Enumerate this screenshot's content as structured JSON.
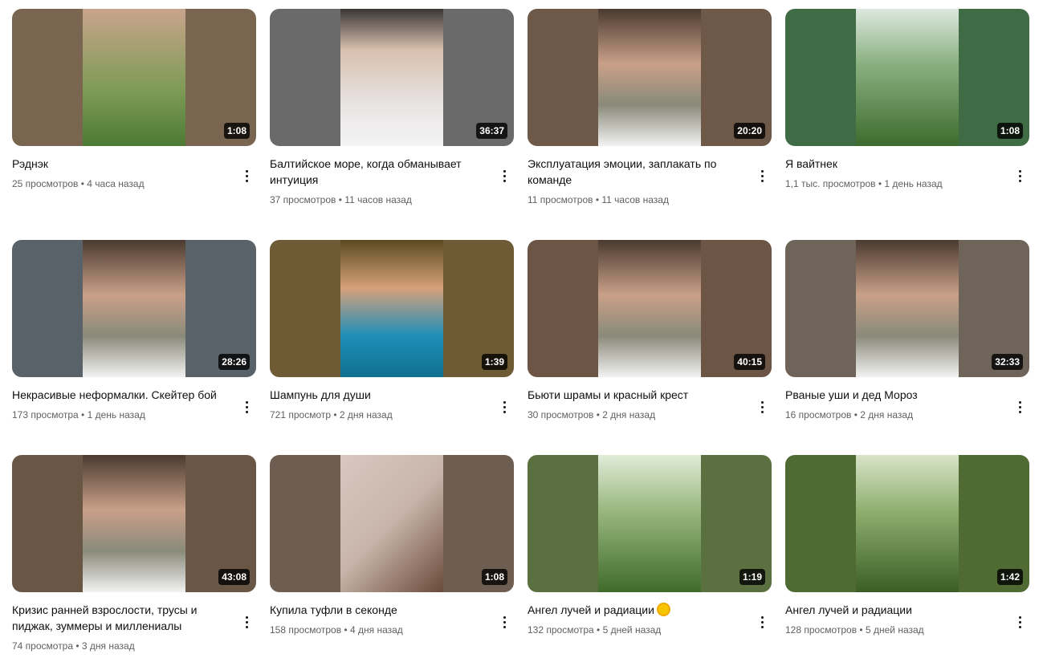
{
  "videos": [
    {
      "title": "Рэднэк",
      "views": "25 просмотров",
      "age": "4 часа назад",
      "duration": "1:08",
      "side": "#7a6650",
      "center": "linear-gradient(180deg,#c9a48c,#7d9b55 60%,#4d7a36)"
    },
    {
      "title": "Балтийское море, когда обманывает интуиция",
      "views": "37 просмотров",
      "age": "11 часов назад",
      "duration": "36:37",
      "side": "#6a6a6a",
      "center": "linear-gradient(180deg,#3a3636,#d8c0ae 30%,#e8e4e4 70%,#f4f4f4)"
    },
    {
      "title": "Эксплуатация эмоции, заплакать по команде",
      "views": "11 просмотров",
      "age": "11 часов назад",
      "duration": "20:20",
      "side": "#6e5848",
      "center": "linear-gradient(180deg,#4a3a30,#c9a088 40%,#8a8a7a 70%,#f2f2f2)"
    },
    {
      "title": "Я вайтнек",
      "views": "1,1 тыс. просмотров",
      "age": "1 день назад",
      "duration": "1:08",
      "side": "#3f6c45",
      "center": "linear-gradient(180deg,#dde8e0,#8ab080 40%,#3d6b2e)"
    },
    {
      "title": "Некрасивые неформалки. Скейтер бой",
      "views": "173 просмотра",
      "age": "1 день назад",
      "duration": "28:26",
      "side": "#596268",
      "center": "linear-gradient(180deg,#4a3a30,#c9a088 40%,#8a8a7a 70%,#f2f2f2)"
    },
    {
      "title": "Шампунь для души",
      "views": "721 просмотр",
      "age": "2 дня назад",
      "duration": "1:39",
      "side": "#6e5a34",
      "center": "linear-gradient(180deg,#5a4a20,#d6a07a 35%,#1e8fb8 70%,#107090)"
    },
    {
      "title": "Бьюти шрамы и красный крест",
      "views": "30 просмотров",
      "age": "2 дня назад",
      "duration": "40:15",
      "side": "#6d5545",
      "center": "linear-gradient(180deg,#4a3a30,#c9a088 40%,#8a8a7a 70%,#f2f2f2)"
    },
    {
      "title": "Рваные уши и дед Мороз",
      "views": "16 просмотров",
      "age": "2 дня назад",
      "duration": "32:33",
      "side": "#6f645a",
      "center": "linear-gradient(180deg,#4a3a30,#c9a088 40%,#8a8a7a 70%,#f2f2f2)"
    },
    {
      "title": "Кризис ранней взрослости, трусы и пиджак, зуммеры и миллениалы",
      "views": "74 просмотра",
      "age": "3 дня назад",
      "duration": "43:08",
      "side": "#6a5645",
      "center": "linear-gradient(180deg,#4a3a30,#c9a088 40%,#8a8a7a 70%,#f2f2f2)"
    },
    {
      "title": "Купила туфли в секонде",
      "views": "158 просмотров",
      "age": "4 дня назад",
      "duration": "1:08",
      "side": "#6e5e52",
      "center": "linear-gradient(135deg,#d8c8c0,#c8b4aa 50%,#6a4a3a)"
    },
    {
      "title": "Ангел лучей и радиации",
      "views": "132 просмотра",
      "age": "5 дней назад",
      "duration": "1:19",
      "side": "#5a7040",
      "center": "linear-gradient(180deg,#e0ecd8,#9ab880 40%,#3f6b2a)",
      "emoji": "sun"
    },
    {
      "title": "Ангел лучей и радиации",
      "views": "128 просмотров",
      "age": "5 дней назад",
      "duration": "1:42",
      "side": "#4f6a32",
      "center": "linear-gradient(180deg,#d8e4c8,#90b070 40%,#3a5e26)"
    }
  ]
}
